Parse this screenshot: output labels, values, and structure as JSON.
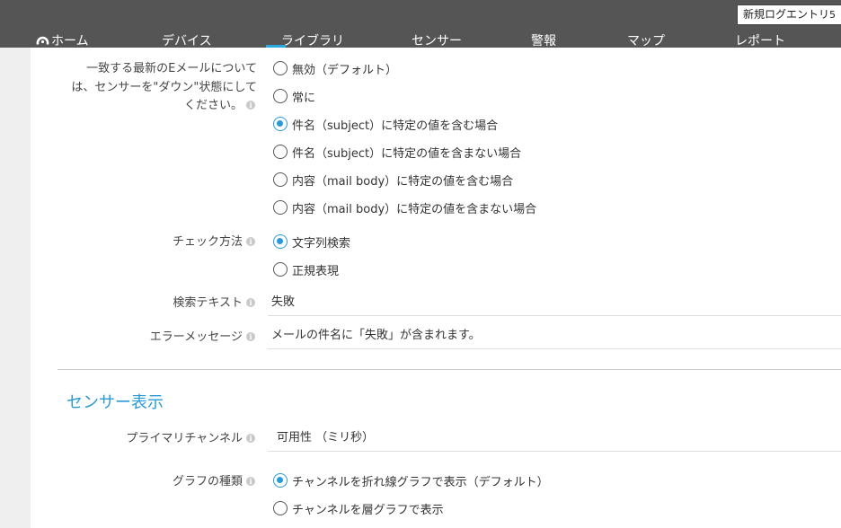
{
  "topbar": {
    "new_log_label": "新規ログエントリ",
    "new_log_count": "5"
  },
  "nav": [
    {
      "label": "ホーム"
    },
    {
      "label": "デバイス"
    },
    {
      "label": "ライブラリ"
    },
    {
      "label": "センサー"
    },
    {
      "label": "警報"
    },
    {
      "label": "マップ"
    },
    {
      "label": "レポート"
    }
  ],
  "settings": {
    "match_email": {
      "label_line1": "一致する最新のEメールについて",
      "label_line2": "は、センサーを\"ダウン\"状態にして",
      "label_line3": "ください。",
      "options": [
        {
          "label": "無効（デフォルト）",
          "checked": false
        },
        {
          "label": "常に",
          "checked": false
        },
        {
          "label": "件名（subject）に特定の値を含む場合",
          "checked": true
        },
        {
          "label": "件名（subject）に特定の値を含まない場合",
          "checked": false
        },
        {
          "label": "内容（mail body）に特定の値を含む場合",
          "checked": false
        },
        {
          "label": "内容（mail body）に特定の値を含まない場合",
          "checked": false
        }
      ]
    },
    "check_method": {
      "label": "チェック方法",
      "options": [
        {
          "label": "文字列検索",
          "checked": true
        },
        {
          "label": "正規表現",
          "checked": false
        }
      ]
    },
    "search_text": {
      "label": "検索テキスト",
      "value": "失敗"
    },
    "error_message": {
      "label": "エラーメッセージ",
      "value": "メールの件名に「失敗」が含まれます。"
    }
  },
  "sensor_display": {
    "title": "センサー表示",
    "primary_channel": {
      "label": "プライマリチャンネル",
      "value": "可用性 （ミリ秒）"
    },
    "graph_type": {
      "label": "グラフの種類",
      "options": [
        {
          "label": "チャンネルを折れ線グラフで表示（デフォルト）",
          "checked": true
        },
        {
          "label": "チャンネルを層グラフで表示",
          "checked": false
        }
      ]
    }
  },
  "colors": {
    "topbar": "#555555",
    "accent": "#2a9ad6",
    "nav_active_underline": "#2aa8e0"
  }
}
